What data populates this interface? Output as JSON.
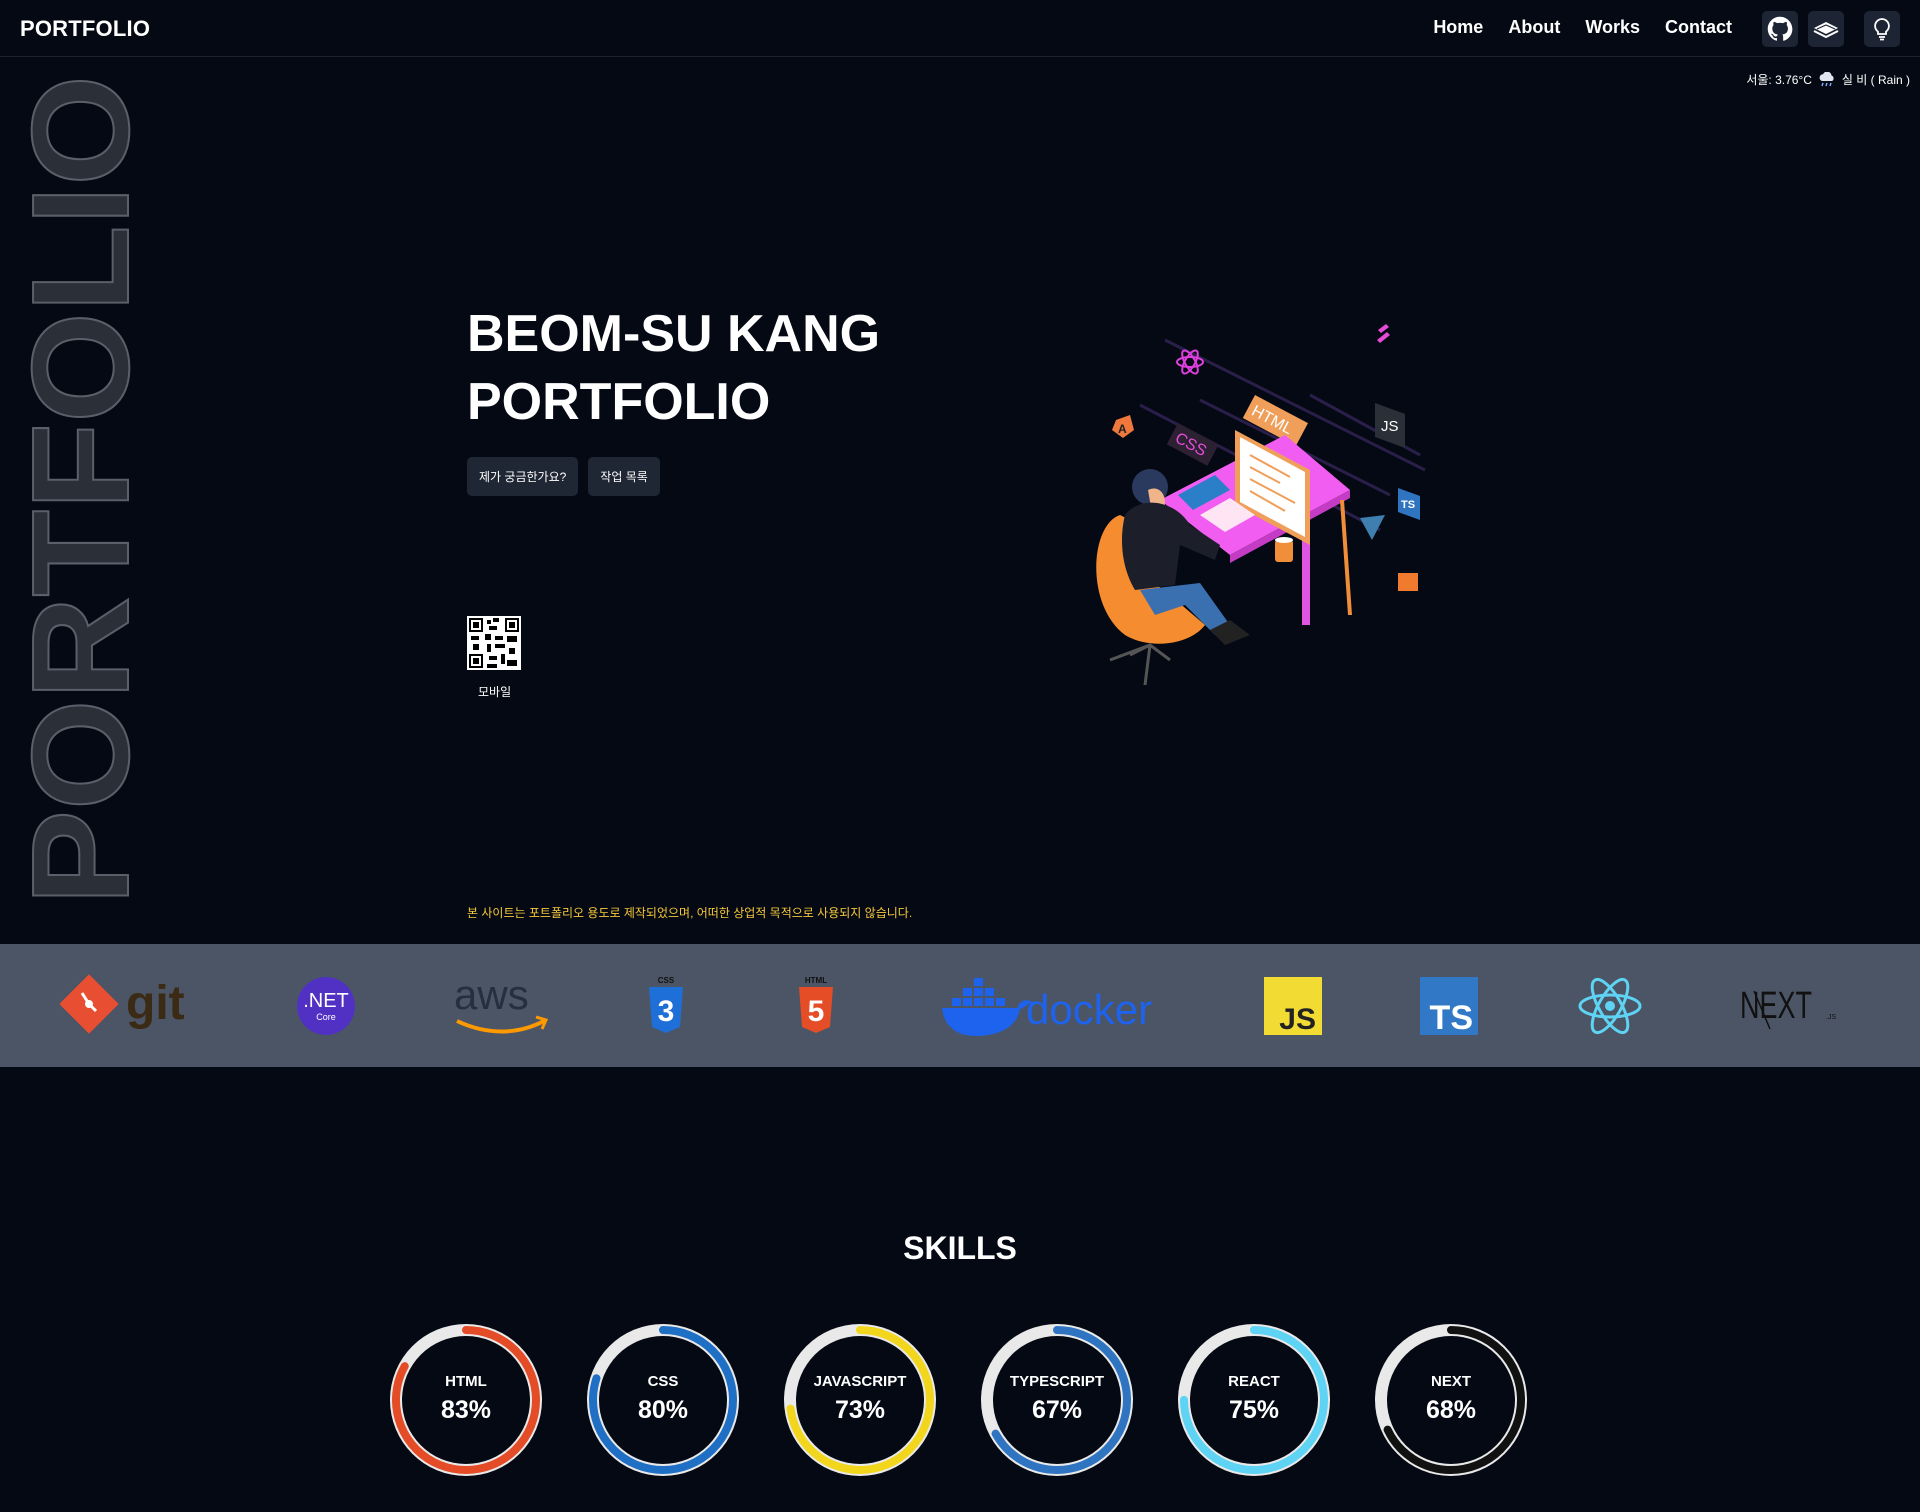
{
  "nav": {
    "brand": "PORTFOLIO",
    "items": [
      {
        "label": "Home"
      },
      {
        "label": "About"
      },
      {
        "label": "Works"
      },
      {
        "label": "Contact"
      }
    ],
    "icons": [
      "github-icon",
      "book-icon",
      "lightbulb-icon"
    ]
  },
  "weather": {
    "text": "서울: 3.76°C",
    "condition": "실 비 ( Rain )"
  },
  "side_word": "PORTFOLIO",
  "hero": {
    "title_line1": "BEOM-SU KANG",
    "title_line2": "PORTFOLIO",
    "button_about": "제가 궁금한가요?",
    "button_works": "작업 목록",
    "qr_label": "모바일",
    "disclaimer": "본 사이트는 포트폴리오 용도로 제작되었으며, 어떠한 상업적 목적으로 사용되지 않습니다.",
    "illustration_tags": [
      "HTML",
      "CSS",
      "JS",
      "TS",
      "A"
    ]
  },
  "tech_logos": [
    {
      "name": "git",
      "text": "git"
    },
    {
      "name": "dotnet",
      "text": ".NET",
      "sub": "Core"
    },
    {
      "name": "aws",
      "text": "aws"
    },
    {
      "name": "css3",
      "text": "CSS"
    },
    {
      "name": "html5",
      "text": "HTML"
    },
    {
      "name": "docker",
      "text": "docker"
    },
    {
      "name": "javascript",
      "text": "JS"
    },
    {
      "name": "typescript",
      "text": "TS"
    },
    {
      "name": "react",
      "text": ""
    },
    {
      "name": "nextjs",
      "text": "NEXT",
      "sub": ".JS"
    }
  ],
  "skills": {
    "title": "SKILLS",
    "items": [
      {
        "name": "HTML",
        "percent": "83%",
        "value": 83,
        "color": "#e34c26"
      },
      {
        "name": "CSS",
        "percent": "80%",
        "value": 80,
        "color": "#1f6fc5"
      },
      {
        "name": "JAVASCRIPT",
        "percent": "73%",
        "value": 73,
        "color": "#f2d61d"
      },
      {
        "name": "TYPESCRIPT",
        "percent": "67%",
        "value": 67,
        "color": "#2f74c0"
      },
      {
        "name": "REACT",
        "percent": "75%",
        "value": 75,
        "color": "#5ed3f3"
      },
      {
        "name": "NEXT",
        "percent": "68%",
        "value": 68,
        "color": "#111111"
      }
    ]
  },
  "colors": {
    "background": "#050913",
    "strip": "#4b5565",
    "disclaimer": "#f6c83b"
  }
}
